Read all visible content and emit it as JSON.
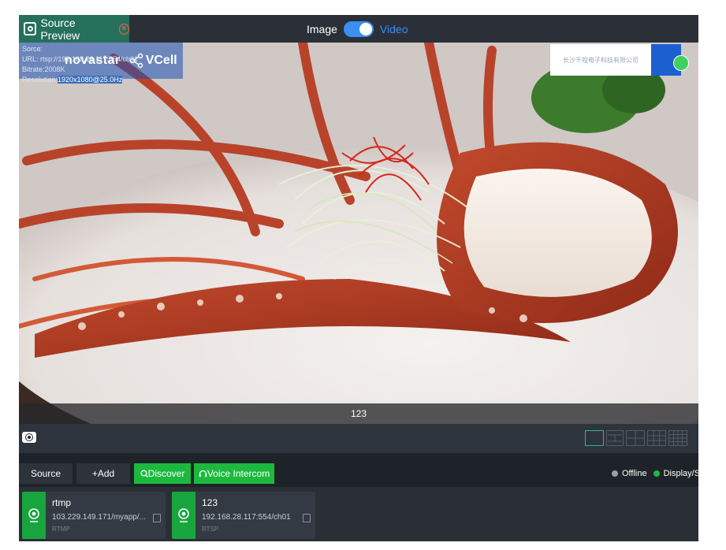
{
  "header": {
    "source_preview_label": "Source Preview",
    "mode_image_label": "Image",
    "mode_video_label": "Video",
    "mode_selected": "Video"
  },
  "preview": {
    "info_line1": "Sorce:",
    "info_url_prefix": "URL:",
    "info_url": "rtsp://192.168.28.117:554/ch01",
    "info_bitrate": "Bitrate:2008K",
    "info_resolution_label": "Resolution:",
    "info_resolution_value": "1920x1080@25.0Hz",
    "logo_text": "novastar",
    "logo_text2": "VCell",
    "company_text": "长沙千视电子科技有限公司",
    "caption": "123"
  },
  "toolbar": {
    "source_label": "Source",
    "add_label": "+Add",
    "discover_label": "Discover",
    "voice_intercom_label": "Voice Intercom"
  },
  "legend": {
    "offline_label": "Offline",
    "display_label": "Display/S",
    "offline_color": "#9aa0a8",
    "display_color": "#1db93f"
  },
  "sources": [
    {
      "name": "rtmp",
      "url": "103.229.149.171/myapp/...",
      "protocol": "RTMP"
    },
    {
      "name": "123",
      "url": "192.168.28.117:554/ch01",
      "protocol": "RTSP"
    }
  ],
  "colors": {
    "accent_green": "#1db93f",
    "accent_blue": "#3a8ff0",
    "tab_green": "#25705b"
  }
}
